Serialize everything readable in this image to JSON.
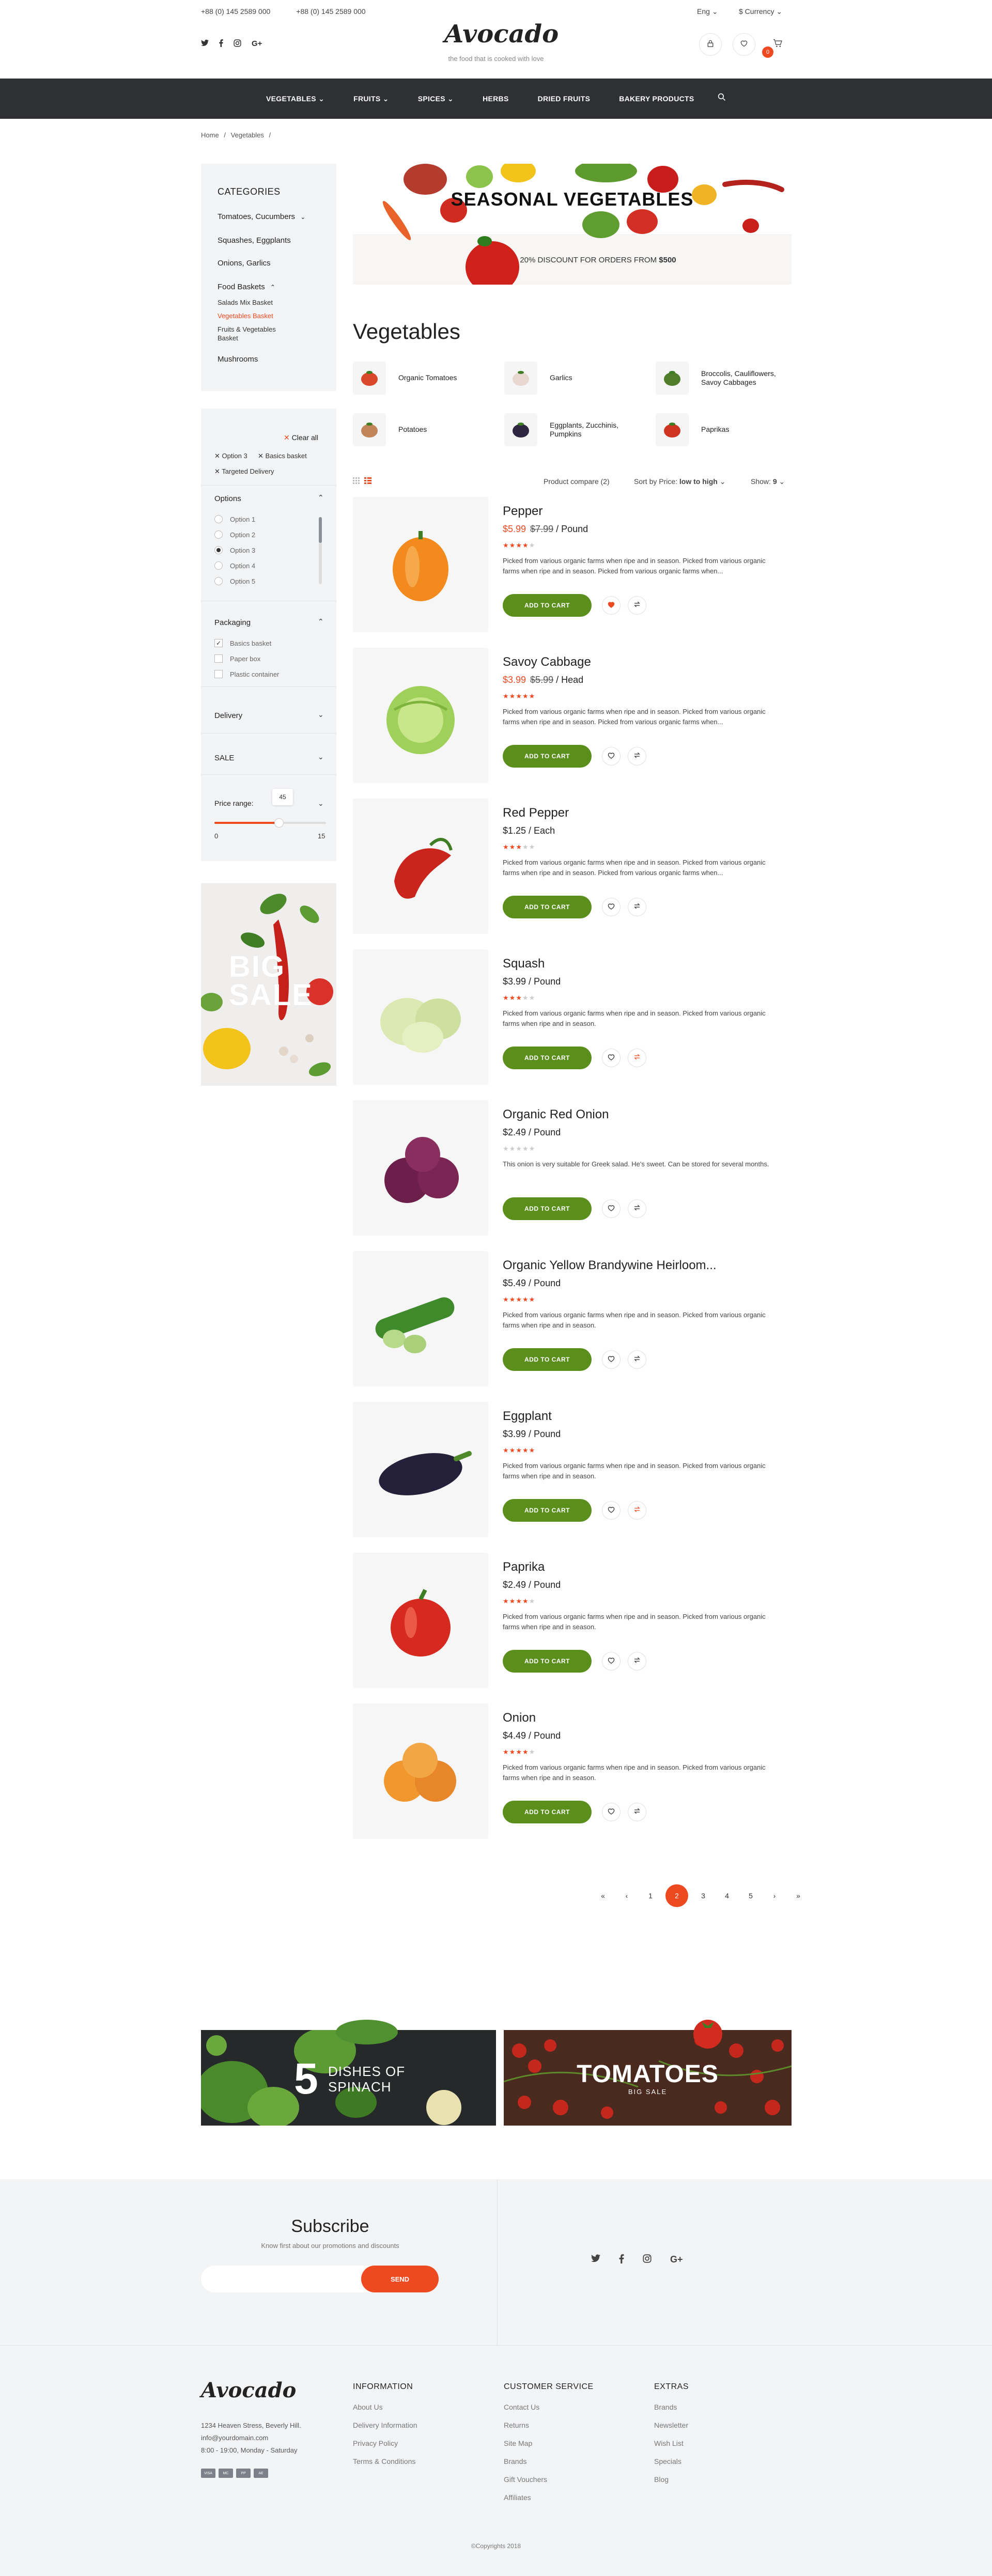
{
  "header": {
    "phone_1": "+88 (0) 145 2589 000",
    "phone_2": "+88 (0) 145 2589 000",
    "logo": "Avocado",
    "tagline": "the food that is cooked with love",
    "lang": "Eng",
    "currency": "$ Currency",
    "cart_count": "0",
    "socials": [
      "twitter-icon",
      "facebook-icon",
      "instagram-icon",
      "google-plus-icon"
    ]
  },
  "nav": {
    "items": [
      {
        "label": "VEGETABLES",
        "dropdown": true
      },
      {
        "label": "FRUITS",
        "dropdown": true
      },
      {
        "label": "SPICES",
        "dropdown": true
      },
      {
        "label": "HERBS",
        "dropdown": false
      },
      {
        "label": "DRIED FRUITS",
        "dropdown": false
      },
      {
        "label": "BAKERY PRODUCTS",
        "dropdown": false
      }
    ]
  },
  "breadcrumb": {
    "home": "Home",
    "sep": "/",
    "current": "Vegetables",
    "sep2": "/"
  },
  "sidebar": {
    "title": "CATEGORIES",
    "cats": [
      "Tomatoes, Cucumbers",
      "Squashes, Eggplants",
      "Onions, Garlics",
      "Food Baskets",
      "Mushrooms"
    ],
    "subcats": [
      "Salads Mix Basket",
      "Vegetables Basket",
      "Fruits & Vegetables",
      "Basket"
    ],
    "clear_all": "Clear all",
    "active_filters": [
      "Option 3",
      "Basics basket",
      "Targeted Delivery"
    ],
    "options_title": "Options",
    "options": [
      "Option 1",
      "Option 2",
      "Option 3",
      "Option 4",
      "Option 5"
    ],
    "packaging_title": "Packaging",
    "packaging": [
      "Basics basket",
      "Paper box",
      "Plastic container"
    ],
    "delivery_title": "Delivery",
    "sale_title": "SALE",
    "price_title": "Price range:",
    "price_bubble": "45",
    "price_min": "0",
    "price_max": "15",
    "price_fraction": 0.58,
    "big_sale_1": "BIG",
    "big_sale_2": "SALE"
  },
  "banner": {
    "title": "SEASONAL VEGETABLES",
    "sub": "20% DISCOUNT FOR ORDERS FROM ",
    "sub_bold": "$500"
  },
  "page_title": "Vegetables",
  "categories": [
    "Organic Tomatoes",
    "Garlics",
    "Broccolis, Cauliflowers, Savoy Cabbages",
    "Potatoes",
    "Eggplants, Zucchinis, Pumpkins",
    "Paprikas"
  ],
  "toolbar": {
    "compare": "Product compare (2)",
    "sort_label": "Sort by Price:",
    "sort_value": "low to high",
    "show_label": "Show:",
    "show_value": "9"
  },
  "add_to_cart": "ADD TO CART",
  "products": [
    {
      "name": "Pepper",
      "price": "$5.99",
      "old": "$7.99",
      "unit": " / Pound",
      "rating": 4,
      "desc": "Picked from various organic farms when ripe and in season. Picked from various organic farms when ripe and in season. Picked from various organic farms when...",
      "fav": true,
      "compare": false
    },
    {
      "name": "Savoy Cabbage",
      "price": "$3.99",
      "old": "$5.99",
      "unit": " / Head",
      "rating": 5,
      "desc": "Picked from various organic farms when ripe and in season. Picked from various organic farms when ripe and in season. Picked from various organic farms when...",
      "fav": false,
      "compare": false
    },
    {
      "name": "Red Pepper",
      "price": "$1.25",
      "old": "",
      "unit": " / Each",
      "rating": 3,
      "desc": "Picked from various organic farms when ripe and in season. Picked from various organic farms when ripe and in season. Picked from various organic farms when...",
      "fav": false,
      "compare": false
    },
    {
      "name": "Squash",
      "price": "$3.99",
      "old": "",
      "unit": " / Pound",
      "rating": 3,
      "desc": "Picked from various organic farms when ripe and in season. Picked from various organic farms when ripe and in season.",
      "fav": false,
      "compare": true
    },
    {
      "name": "Organic Red Onion",
      "price": "$2.49",
      "old": "",
      "unit": " / Pound",
      "rating": 0,
      "desc": "This onion is very suitable for Greek salad. He's sweet. Can be stored for several months.",
      "fav": false,
      "compare": false
    },
    {
      "name": "Organic Yellow Brandywine Heirloom...",
      "price": "$5.49",
      "old": "",
      "unit": " / Pound",
      "rating": 5,
      "desc": "Picked from various organic farms when ripe and in season. Picked from various organic farms when ripe and in season.",
      "fav": false,
      "compare": false
    },
    {
      "name": "Eggplant",
      "price": "$3.99",
      "old": "",
      "unit": " / Pound",
      "rating": 5,
      "desc": "Picked from various organic farms when ripe and in season. Picked from various organic farms when ripe and in season.",
      "fav": false,
      "compare": true
    },
    {
      "name": "Paprika",
      "price": "$2.49",
      "old": "",
      "unit": " / Pound",
      "rating": 4,
      "desc": "Picked from various organic farms when ripe and in season. Picked from various organic farms when ripe and in season.",
      "fav": false,
      "compare": false
    },
    {
      "name": "Onion",
      "price": "$4.49",
      "old": "",
      "unit": " / Pound",
      "rating": 4,
      "desc": "Picked from various organic farms when ripe and in season. Picked from various organic farms when ripe and in season.",
      "fav": false,
      "compare": false
    }
  ],
  "pagination": [
    "«",
    "‹",
    "1",
    "2",
    "3",
    "4",
    "5",
    "›",
    "»"
  ],
  "pagination_active": "2",
  "promos": {
    "spinach_num": "5",
    "spinach_1": "DISHES OF",
    "spinach_2": "SPINACH",
    "tomatoes": "TOMATOES",
    "tomatoes_sub": "BIG SALE"
  },
  "subscribe": {
    "title": "Subscribe",
    "text": "Know first about our promotions and discounts",
    "send": "SEND"
  },
  "footer": {
    "logo": "Avocado",
    "address": [
      "1234 Heaven Stress, Beverly Hill.",
      "info@yourdomain.com",
      "8:00 - 19:00, Monday - Saturday"
    ],
    "cols": [
      {
        "title": "INFORMATION",
        "links": [
          "About Us",
          "Delivery Information",
          "Privacy Policy",
          "Terms & Conditions"
        ]
      },
      {
        "title": "CUSTOMER SERVICE",
        "links": [
          "Contact Us",
          "Returns",
          "Site Map",
          "Brands",
          "Gift Vouchers",
          "Affiliates"
        ]
      },
      {
        "title": "EXTRAS",
        "links": [
          "Brands",
          "Newsletter",
          "Wish List",
          "Specials",
          "Blog"
        ]
      }
    ],
    "copyright": "©Copyrights 2018"
  },
  "colors": {
    "accent": "#ee4a22",
    "green": "#5a8f1c",
    "dark": "#2e3033"
  }
}
